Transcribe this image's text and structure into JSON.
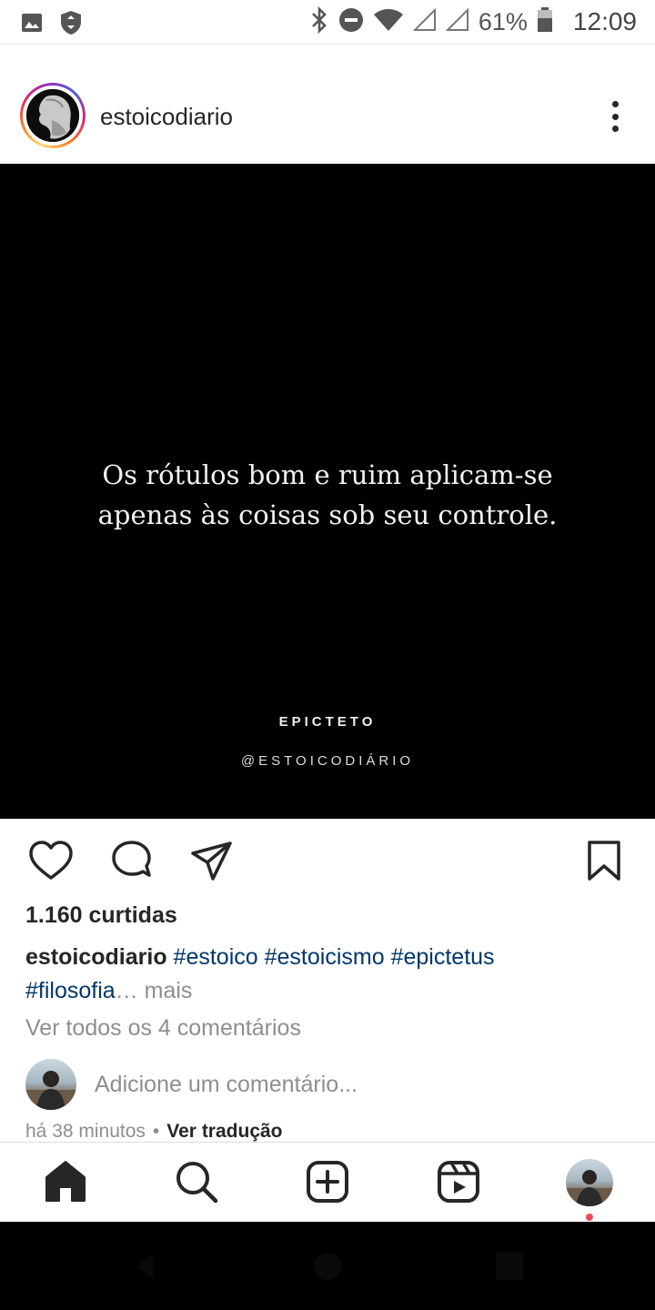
{
  "status_bar": {
    "battery": "61%",
    "time": "12:09",
    "icons": [
      "image-icon",
      "vpn-shield-icon",
      "bluetooth-icon",
      "do-not-disturb-icon",
      "wifi-icon",
      "signal-icon",
      "signal-icon",
      "battery-icon"
    ]
  },
  "post": {
    "username": "estoicodiario",
    "quote_line1": "Os rótulos bom e ruim aplicam-se",
    "quote_line2": "apenas às coisas sob seu controle.",
    "author": "EPICTETO",
    "handle": "@ESTOICODIÁRIO"
  },
  "engagement": {
    "likes": "1.160 curtidas",
    "caption_user": "estoicodiario",
    "tag1": "#estoico",
    "tag2": "#estoicismo",
    "tag3": "#epictetus",
    "tag4": "#filosofia",
    "ellipsis": "…",
    "more": "mais",
    "view_comments": "Ver todos os 4 comentários",
    "add_comment_placeholder": "Adicione um comentário...",
    "time_ago": "há 38 minutos",
    "separator": "•",
    "see_translation": "Ver tradução"
  },
  "nav": {
    "items": [
      "home-icon",
      "search-icon",
      "new-post-icon",
      "reels-icon",
      "profile-avatar"
    ]
  }
}
